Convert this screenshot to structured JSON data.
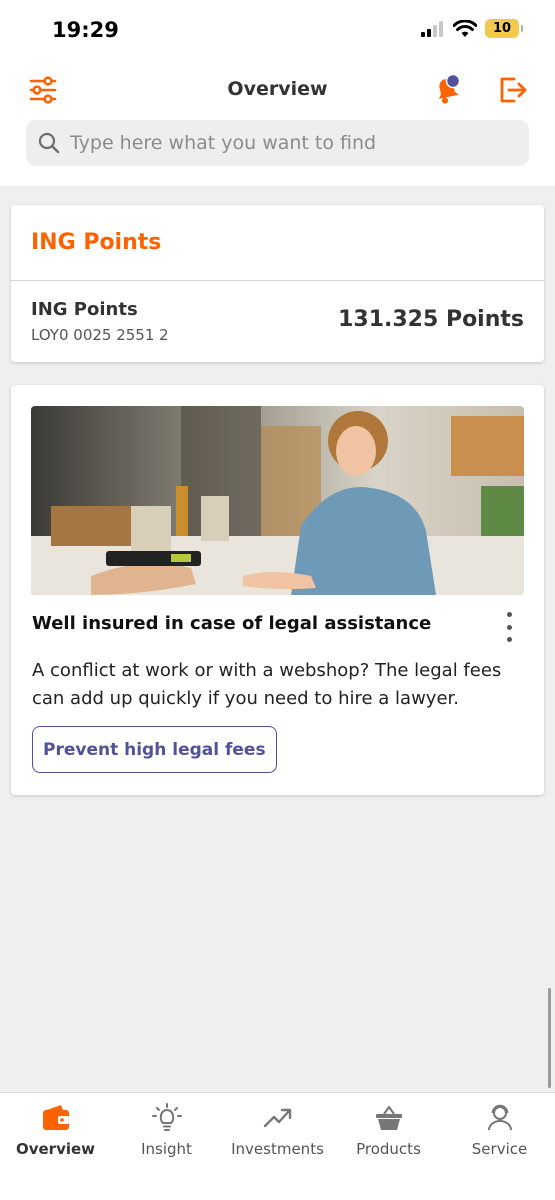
{
  "status_bar": {
    "time": "19:29",
    "battery": "10"
  },
  "header": {
    "title": "Overview",
    "menu_icon": "sliders-icon",
    "notification_icon": "bell-icon",
    "logout_icon": "logout-icon"
  },
  "search": {
    "placeholder": "Type here what you want to find",
    "value": ""
  },
  "points_card": {
    "heading": "ING Points",
    "account_name": "ING Points",
    "account_id": "LOY0 0025 2551 2",
    "balance": "131.325 Points"
  },
  "promo_card": {
    "title": "Well insured in case of legal assistance",
    "body": "A conflict at work or with a webshop? The legal fees can add up quickly if you need to hire a lawyer.",
    "button_label": "Prevent high legal fees"
  },
  "tabs": [
    {
      "label": "Overview",
      "icon": "wallet-icon",
      "active": true
    },
    {
      "label": "Insight",
      "icon": "lightbulb-icon",
      "active": false
    },
    {
      "label": "Investments",
      "icon": "trend-up-icon",
      "active": false
    },
    {
      "label": "Products",
      "icon": "basket-icon",
      "active": false
    },
    {
      "label": "Service",
      "icon": "person-icon",
      "active": false
    }
  ],
  "colors": {
    "brand_orange": "#ff6200",
    "accent_purple": "#525199",
    "notification_dot": "#525199"
  }
}
